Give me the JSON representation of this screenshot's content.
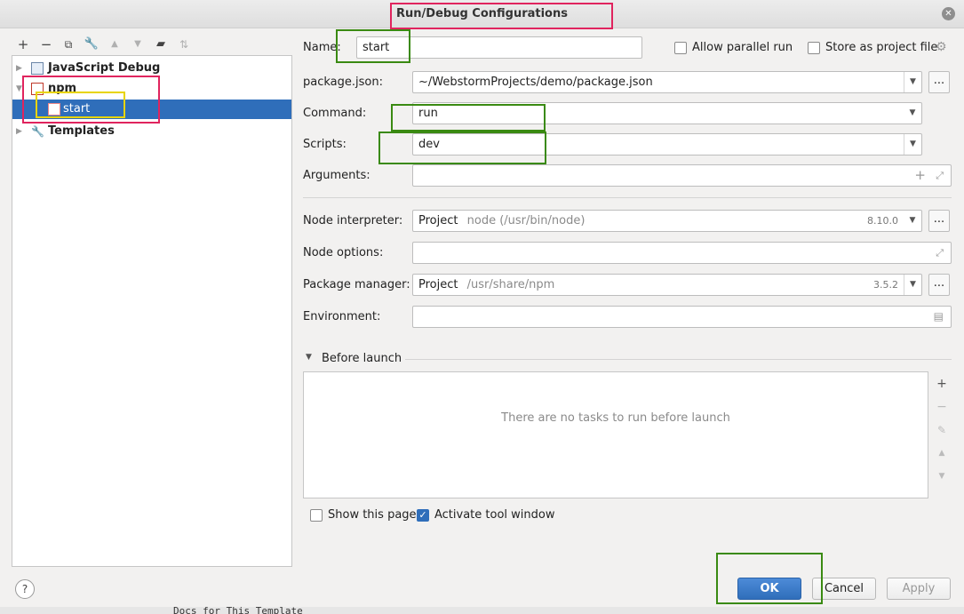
{
  "window": {
    "title": "Run/Debug Configurations"
  },
  "tree": {
    "items": [
      {
        "label": "JavaScript Debug"
      },
      {
        "label": "npm"
      },
      {
        "label": "start"
      },
      {
        "label": "Templates"
      }
    ]
  },
  "form": {
    "name_label": "Name:",
    "name_value": "start",
    "allow_parallel_label": "Allow parallel run",
    "store_project_label": "Store as project file",
    "package_json_label": "package.json:",
    "package_json_value": "~/WebstormProjects/demo/package.json",
    "command_label": "Command:",
    "command_value": "run",
    "scripts_label": "Scripts:",
    "scripts_value": "dev",
    "arguments_label": "Arguments:",
    "node_interpreter_label": "Node interpreter:",
    "node_interpreter_value": "Project",
    "node_interpreter_path": "node (/usr/bin/node)",
    "node_interpreter_version": "8.10.0",
    "node_options_label": "Node options:",
    "package_manager_label": "Package manager:",
    "package_manager_value": "Project",
    "package_manager_path": "/usr/share/npm",
    "package_manager_version": "3.5.2",
    "environment_label": "Environment:",
    "ellipsis": "..."
  },
  "before_launch": {
    "title": "Before launch",
    "empty_text": "There are no tasks to run before launch",
    "show_page_label": "Show this page",
    "activate_window_label": "Activate tool window",
    "show_page_checked": false,
    "activate_window_checked": true
  },
  "buttons": {
    "ok": "OK",
    "cancel": "Cancel",
    "apply": "Apply",
    "help": "?"
  },
  "background_text": "Docs for This Template",
  "colors": {
    "selection": "#2f6eba",
    "annotation_red": "#e0245e",
    "annotation_green": "#3a8a12",
    "annotation_yellow": "#e8d400"
  }
}
